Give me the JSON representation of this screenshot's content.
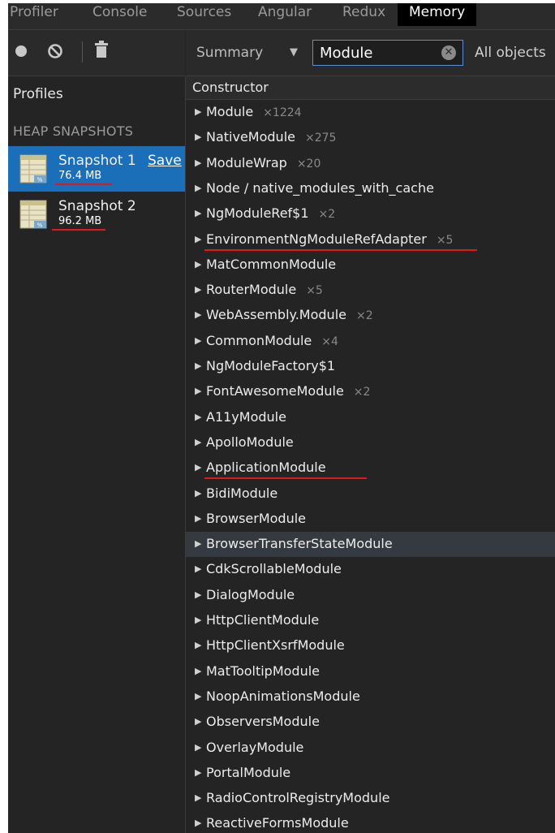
{
  "tabs": [
    {
      "label": "Profiler",
      "active": false
    },
    {
      "label": "Console",
      "active": false
    },
    {
      "label": "Sources",
      "active": false
    },
    {
      "label": "Angular",
      "active": false
    },
    {
      "label": "Redux",
      "active": false
    },
    {
      "label": "Memory",
      "active": true
    }
  ],
  "toolbar": {
    "icons": [
      "record-icon",
      "clear-icon",
      "delete-icon"
    ]
  },
  "sidebar": {
    "profiles_title": "Profiles",
    "heap_title": "HEAP SNAPSHOTS",
    "snapshots": [
      {
        "name": "Snapshot 1",
        "size": "76.4 MB",
        "save_label": "Save",
        "selected": true
      },
      {
        "name": "Snapshot 2",
        "size": "96.2 MB",
        "selected": false
      }
    ]
  },
  "filter": {
    "view": "Summary",
    "class_filter": "Module",
    "objects": "All objects"
  },
  "table": {
    "column": "Constructor",
    "rows": [
      {
        "name": "Module",
        "count": "×1224"
      },
      {
        "name": "NativeModule",
        "count": "×275"
      },
      {
        "name": "ModuleWrap",
        "count": "×20"
      },
      {
        "name": "Node / native_modules_with_cache",
        "count": ""
      },
      {
        "name": "NgModuleRef$1",
        "count": "×2"
      },
      {
        "name": "EnvironmentNgModuleRefAdapter",
        "count": "×5"
      },
      {
        "name": "MatCommonModule",
        "count": ""
      },
      {
        "name": "RouterModule",
        "count": "×5"
      },
      {
        "name": "WebAssembly.Module",
        "count": "×2"
      },
      {
        "name": "CommonModule",
        "count": "×4"
      },
      {
        "name": "NgModuleFactory$1",
        "count": ""
      },
      {
        "name": "FontAwesomeModule",
        "count": "×2"
      },
      {
        "name": "A11yModule",
        "count": ""
      },
      {
        "name": "ApolloModule",
        "count": ""
      },
      {
        "name": "ApplicationModule",
        "count": ""
      },
      {
        "name": "BidiModule",
        "count": ""
      },
      {
        "name": "BrowserModule",
        "count": ""
      },
      {
        "name": "BrowserTransferStateModule",
        "count": ""
      },
      {
        "name": "CdkScrollableModule",
        "count": ""
      },
      {
        "name": "DialogModule",
        "count": ""
      },
      {
        "name": "HttpClientModule",
        "count": ""
      },
      {
        "name": "HttpClientXsrfModule",
        "count": ""
      },
      {
        "name": "MatTooltipModule",
        "count": ""
      },
      {
        "name": "NoopAnimationsModule",
        "count": ""
      },
      {
        "name": "ObserversModule",
        "count": ""
      },
      {
        "name": "OverlayModule",
        "count": ""
      },
      {
        "name": "PortalModule",
        "count": ""
      },
      {
        "name": "RadioControlRegistryModule",
        "count": ""
      },
      {
        "name": "ReactiveFormsModule",
        "count": ""
      }
    ]
  },
  "colors": {
    "selected": "#1a6fb8",
    "annotation": "#e01818",
    "filter_border": "#5a8fd6"
  }
}
